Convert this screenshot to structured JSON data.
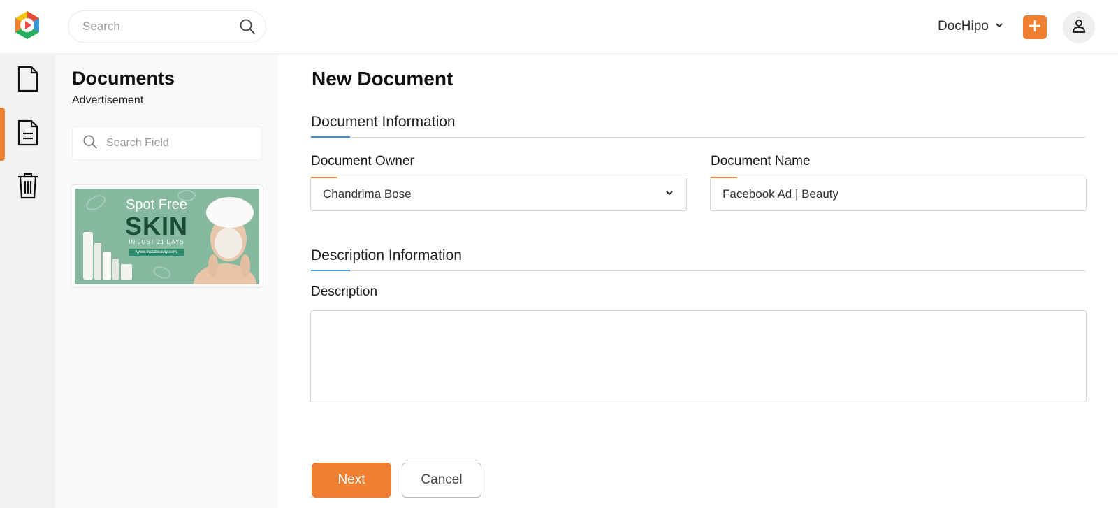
{
  "header": {
    "search_placeholder": "Search",
    "workspace_name": "DocHipo",
    "brand_color": "#ef7f31"
  },
  "rail": {
    "items": [
      {
        "name": "document-icon",
        "active": false
      },
      {
        "name": "document-lines-icon",
        "active": true
      },
      {
        "name": "trash-icon",
        "active": false
      }
    ]
  },
  "docs_panel": {
    "title": "Documents",
    "subtitle": "Advertisement",
    "search_placeholder": "Search Field",
    "thumbnail": {
      "line1": "Spot Free",
      "line2": "SKIN",
      "line3": "IN JUST 21 DAYS",
      "url": "www.instabeauty.com"
    }
  },
  "form": {
    "title": "New Document",
    "section_document": "Document Information",
    "owner_label": "Document Owner",
    "owner_value": "Chandrima Bose",
    "name_label": "Document Name",
    "name_value": "Facebook Ad | Beauty",
    "section_description": "Description Information",
    "description_label": "Description",
    "description_value": "",
    "next_label": "Next",
    "cancel_label": "Cancel"
  }
}
